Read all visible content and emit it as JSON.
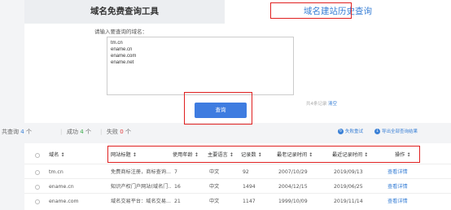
{
  "tabs": {
    "free_query": "域名免费查询工具",
    "history_query": "域名建站历史查询"
  },
  "form": {
    "prompt": "请输入要查询的域名：",
    "domains": [
      "tm.cn",
      "ename.cn",
      "ename.com",
      "ename.net"
    ],
    "count_text": "共4条记录",
    "clear_label": "清空",
    "query_label": "查询"
  },
  "stats": {
    "total_label": "共查询",
    "total_value": "4",
    "total_unit": "个",
    "success_label": "成功",
    "success_value": "4",
    "success_unit": "个",
    "fail_label": "失败",
    "fail_value": "0",
    "fail_unit": "个",
    "retry_label": "失败重试",
    "export_label": "导出全部查询结果"
  },
  "table": {
    "headers": {
      "domain": "域名 ↕",
      "title": "网站标题 ↕",
      "years": "使用年龄 ↕",
      "language": "主要语言 ↕",
      "records": "记录数 ↕",
      "earliest": "最老记录时间 ↕",
      "latest": "最近记录时间 ↕",
      "action": "操作 ↕"
    },
    "rows": [
      {
        "domain": "tm.cn",
        "title": "免费商标注册，商标查询...",
        "years": "7",
        "language": "中文",
        "records": "92",
        "earliest": "2007/10/29",
        "latest": "2019/09/13",
        "action": "查看详情"
      },
      {
        "domain": "ename.cn",
        "title": "知识产权门户网站(域名门...",
        "years": "16",
        "language": "中文",
        "records": "1494",
        "earliest": "2004/12/15",
        "latest": "2019/06/25",
        "action": "查看详情"
      },
      {
        "domain": "ename.com",
        "title": "域名交易平台：域名交易...",
        "years": "21",
        "language": "中文",
        "records": "1147",
        "earliest": "1999/10/09",
        "latest": "2019/11/14",
        "action": "查看详情"
      }
    ]
  },
  "colors": {
    "accent": "#3a80d6",
    "button": "#3e7ce0",
    "highlight_box": "#e02020",
    "success": "#3aab4a",
    "fail": "#e23b3b"
  }
}
